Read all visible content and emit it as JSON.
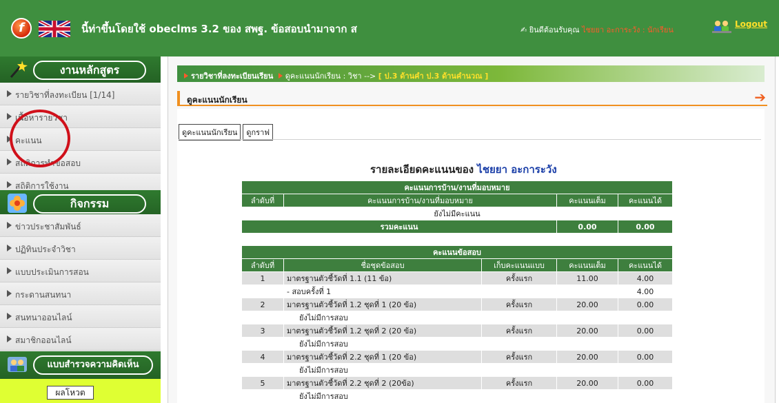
{
  "header": {
    "title": "นี้ท่าขึ้นโดยใช้ obeclms 3.2 ของ สพฐ. ข้อสอบนำมาจาก ส",
    "welcome_prefix": "ยินดีต้อนรับคุณ",
    "welcome_user": "ไชยยา อะการะวัง : นักเรียน",
    "logout_label": "Logout",
    "colors": {
      "header_bg": "#3f8f3f",
      "user_text": "#ff5a2a",
      "logout_text": "#ffe02a"
    }
  },
  "sidebar": {
    "section1": {
      "label": "งานหลักสูตร",
      "icon": "magic-wand-icon"
    },
    "section1_items": [
      {
        "label": "รายวิชาที่ลงทะเบียน [1/14]"
      },
      {
        "label": "เนื้อหารายวิชา"
      },
      {
        "label": "คะแนน"
      },
      {
        "label": "สถิติการทำข้อสอบ"
      },
      {
        "label": "สถิติการใช้งาน"
      }
    ],
    "section2": {
      "label": "กิจกรรม",
      "icon": "flower-icon"
    },
    "section2_items": [
      {
        "label": "ข่าวประชาสัมพันธ์"
      },
      {
        "label": "ปฏิทินประจำวิชา"
      },
      {
        "label": "แบบประเมินการสอน"
      },
      {
        "label": "กระดานสนทนา"
      },
      {
        "label": "สนทนาออนไลน์"
      },
      {
        "label": "สมาชิกออนไลน์"
      }
    ],
    "section3": {
      "label": "แบบสำรวจความคิดเห็น",
      "icon": "people-icon"
    },
    "vote_button": "ผลโหวต"
  },
  "breadcrumb": {
    "part1": "รายวิชาที่ลงทะเบียนเรียน",
    "part2": "ดูคะแนนนักเรียน",
    "part3": "วิชา -->",
    "highlight": "[ ป.3 ด้านคำ ป.3 ด้านคำนวณ ]"
  },
  "panel": {
    "title": "ดูคะแนนนักเรียน"
  },
  "buttons": {
    "view_scores": "ดูคะแนนนักเรียน",
    "view_graph": "ดูกราฟ"
  },
  "report": {
    "title_prefix": "รายละเอียดคะแนนของ",
    "student_name": "ไชยยา อะการะวัง"
  },
  "homework_table": {
    "caption": "คะแนนการบ้าน/งานที่มอบหมาย",
    "columns": [
      "ลำดับที่",
      "คะแนนการบ้าน/งานที่มอบหมาย",
      "คะแนนเต็ม",
      "คะแนนได้"
    ],
    "empty_text": "ยังไม่มีคะแนน",
    "total_label": "รวมคะแนน",
    "total_full": "0.00",
    "total_got": "0.00"
  },
  "exam_table": {
    "caption": "คะแนนข้อสอบ",
    "columns": [
      "ลำดับที่",
      "ชื่อชุดข้อสอบ",
      "เก็บคะแนนแบบ",
      "คะแนนเต็ม",
      "คะแนนได้"
    ],
    "rows": [
      {
        "no": "1",
        "name": "มาตรฐานตัวชี้วัดที่ 1.1 (11 ข้อ)",
        "mode": "ครั้งแรก",
        "full": "11.00",
        "got": "4.00",
        "sub_text": "- สอบครั้งที่ 1",
        "sub_score": "4.00"
      },
      {
        "no": "2",
        "name": "มาตรฐานตัวชี้วัดที่ 1.2 ชุดที่ 1 (20 ข้อ)",
        "mode": "ครั้งแรก",
        "full": "20.00",
        "got": "0.00",
        "sub_text": "ยังไม่มีการสอบ",
        "sub_score": ""
      },
      {
        "no": "3",
        "name": "มาตรฐานตัวชี้วัดที่ 1.2 ชุดที่ 2 (20 ข้อ)",
        "mode": "ครั้งแรก",
        "full": "20.00",
        "got": "0.00",
        "sub_text": "ยังไม่มีการสอบ",
        "sub_score": ""
      },
      {
        "no": "4",
        "name": "มาตรฐานตัวชี้วัดที่ 2.2 ชุดที่ 1 (20 ข้อ)",
        "mode": "ครั้งแรก",
        "full": "20.00",
        "got": "0.00",
        "sub_text": "ยังไม่มีการสอบ",
        "sub_score": ""
      },
      {
        "no": "5",
        "name": "มาตรฐานตัวชี้วัดที่ 2.2 ชุดที่ 2 (20ข้อ)",
        "mode": "ครั้งแรก",
        "full": "20.00",
        "got": "0.00",
        "sub_text": "ยังไม่มีการสอบ",
        "sub_score": ""
      }
    ]
  }
}
